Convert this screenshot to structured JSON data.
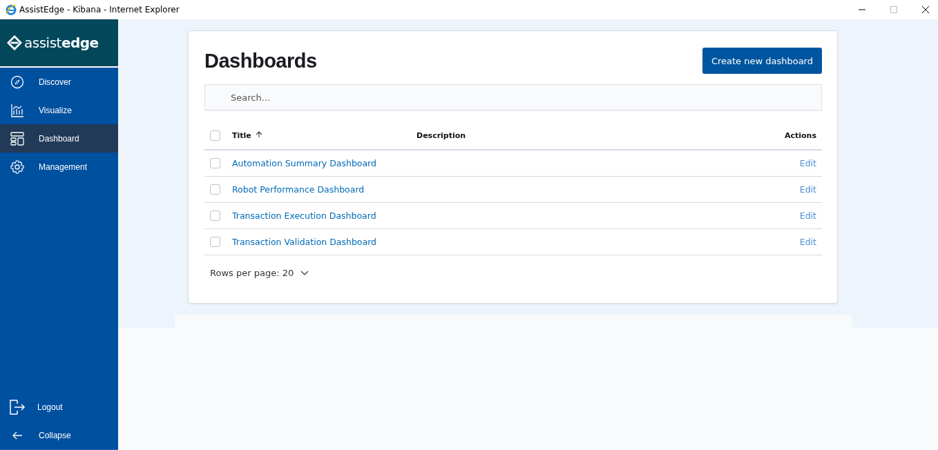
{
  "window": {
    "title": "AssistEdge - Kibana - Internet Explorer"
  },
  "sidebar": {
    "logo": "assist**edge**",
    "items": [
      {
        "label": "Discover",
        "kind": "compass",
        "selected": false
      },
      {
        "label": "Visualize",
        "kind": "chart",
        "selected": false
      },
      {
        "label": "Dashboard",
        "kind": "layout",
        "selected": true
      },
      {
        "label": "Management",
        "kind": "gear",
        "selected": false
      }
    ],
    "footer": [
      {
        "label": "Logout",
        "kind": "logout"
      },
      {
        "label": "Collapse",
        "kind": "back"
      }
    ]
  },
  "page": {
    "title": "Dashboards",
    "create_button": "Create new dashboard",
    "search": {
      "placeholder": "Search..."
    },
    "table": {
      "select_all_checked": false,
      "columns": [
        "Title",
        "Description",
        "Actions"
      ],
      "rows": [
        {
          "title": "Automation Summary Dashboard",
          "action": "Edit",
          "checked": false
        },
        {
          "title": "Robot Performance Dashboard",
          "action": "Edit",
          "checked": false
        },
        {
          "title": "Transaction Execution Dashboard",
          "action": "Edit",
          "checked": false
        },
        {
          "title": "Transaction Validation Dashboard",
          "action": "Edit",
          "checked": false
        }
      ]
    },
    "rows_per_page": "Rows per page: 20"
  }
}
